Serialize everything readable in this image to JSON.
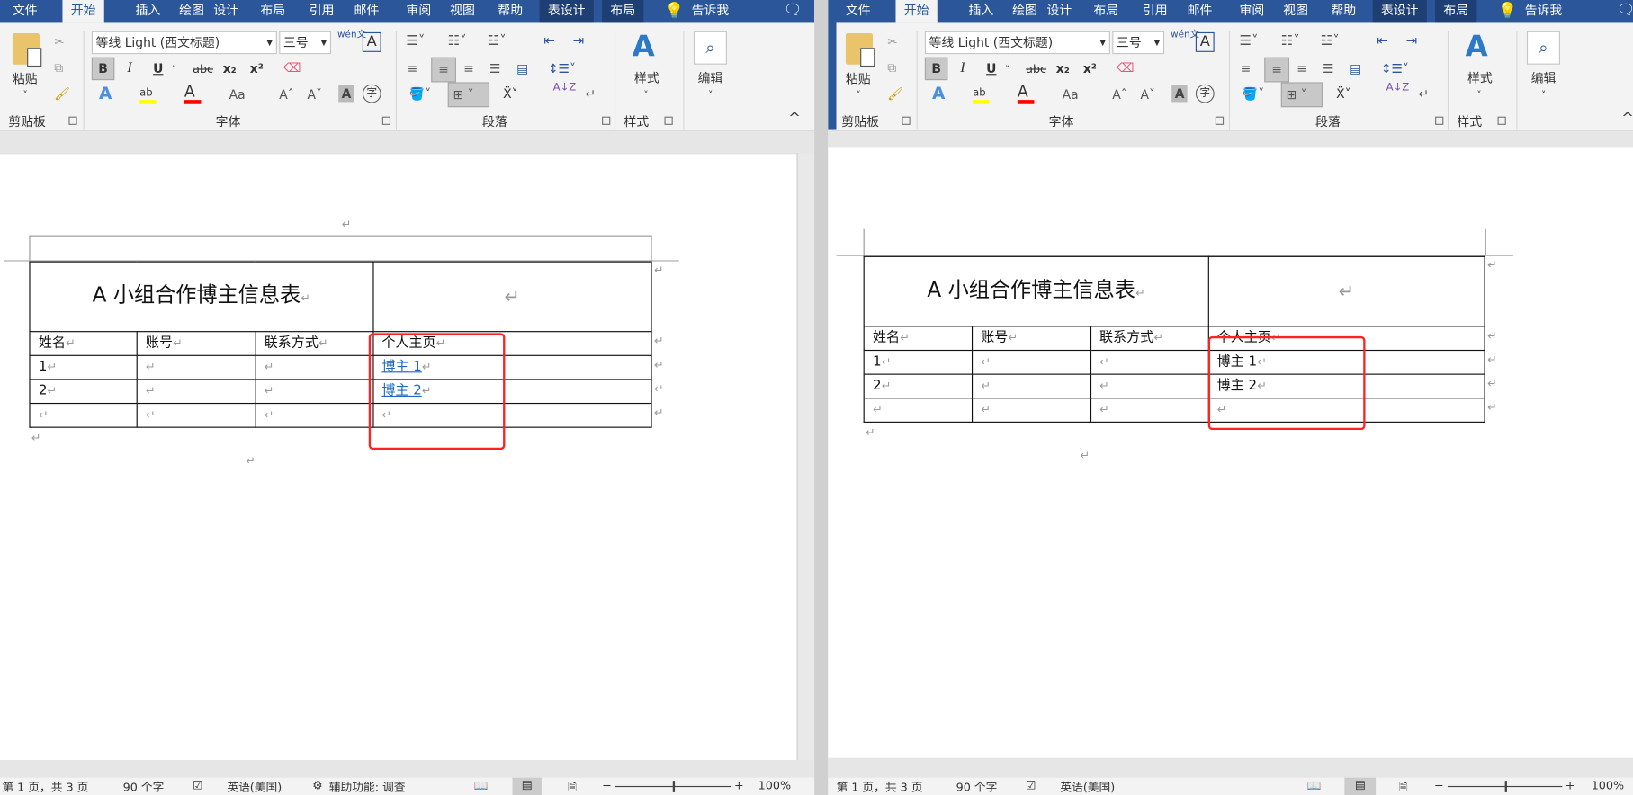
{
  "ribbon": {
    "tabs": [
      "文件",
      "开始",
      "插入",
      "绘图",
      "设计",
      "布局",
      "引用",
      "邮件",
      "审阅",
      "视图",
      "帮助",
      "表设计",
      "布局"
    ],
    "tell_me": "告诉我",
    "font_name": "等线 Light (西文标题)",
    "font_size": "三号",
    "paste": "粘贴",
    "styles": "样式",
    "editing": "编辑",
    "groups": {
      "clipboard": "剪贴板",
      "font": "字体",
      "paragraph": "段落",
      "styles": "样式"
    },
    "buttons": {
      "bold": "B",
      "italic": "I",
      "underline": "U",
      "strike": "abc",
      "sub": "x₂",
      "sup": "x²",
      "wen": "wén文",
      "char_border": "A",
      "text_effect": "A",
      "font_color": "A",
      "case": "Aa",
      "grow": "Aˆ",
      "shrink": "Aˇ",
      "char_shade": "A",
      "enclose": "字",
      "sort": "A↓Z"
    },
    "colors": {
      "highlight": "#ffff00",
      "font_color": "#ff0000",
      "accent": "#2b579a"
    }
  },
  "left_doc": {
    "title": "A 小组合作博主信息表",
    "headers": [
      "姓名",
      "账号",
      "联系方式",
      "个人主页"
    ],
    "rows": [
      [
        "1",
        "",
        "",
        "博主 1"
      ],
      [
        "2",
        "",
        "",
        "博主 2"
      ],
      [
        "",
        "",
        "",
        ""
      ]
    ],
    "links_style": "hyperlink"
  },
  "right_doc": {
    "title": "A 小组合作博主信息表",
    "headers": [
      "姓名",
      "账号",
      "联系方式",
      "个人主页"
    ],
    "rows": [
      [
        "1",
        "",
        "",
        "博主 1"
      ],
      [
        "2",
        "",
        "",
        "博主 2"
      ],
      [
        "",
        "",
        "",
        ""
      ]
    ]
  },
  "status_left": {
    "page": "第 1 页，共 3 页",
    "words": "90 个字",
    "lang": "英语(美国)",
    "accessibility": "辅助功能: 调查",
    "zoom": "100%",
    "zoom_level": 100
  },
  "status_right": {
    "page": "第 1 页，共 3 页",
    "words": "90 个字",
    "lang": "英语(美国)",
    "zoom": "100%",
    "zoom_level": 100
  },
  "pilcrow": "↵"
}
